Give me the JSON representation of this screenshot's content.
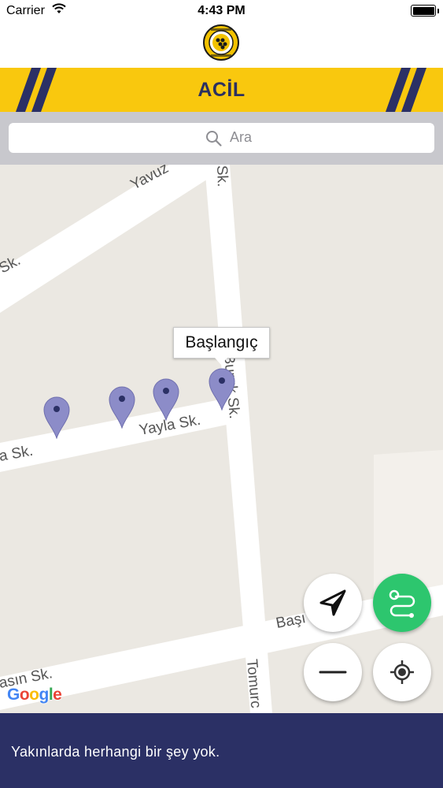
{
  "status_bar": {
    "carrier": "Carrier",
    "time": "4:43 PM",
    "wifi_icon": "wifi-icon",
    "battery_icon": "battery-full-icon"
  },
  "header": {
    "logo_name": "buca-belediyesi-logo",
    "title": "ACİL"
  },
  "colors": {
    "accent": "#F9C80E",
    "navy": "#2B3065",
    "green": "#2DC66E",
    "pin": "#8C8CC8"
  },
  "search": {
    "placeholder": "Ara",
    "value": ""
  },
  "map": {
    "streets": [
      "Yavuz",
      "Sk.",
      "Yayla Sk.",
      "a Sk.",
      "Başı",
      "asın Sk.",
      "Tomurc",
      "Sk.",
      "Buruk Sk."
    ],
    "callout": "Başlangıç",
    "pin_count": 4,
    "attribution": "Google"
  },
  "controls": {
    "navigate_icon": "navigation-arrow-icon",
    "route_icon": "route-icon",
    "zoom_out_icon": "minus-icon",
    "locate_icon": "crosshair-icon"
  },
  "footer": {
    "message": "Yakınlarda herhangi bir şey yok."
  }
}
